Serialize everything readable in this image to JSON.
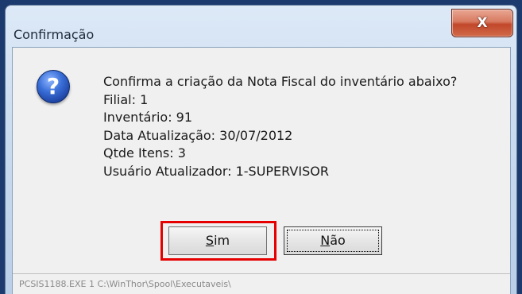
{
  "window": {
    "title": "Confirmação",
    "close_glyph": "X"
  },
  "dialog": {
    "icon": "question-icon",
    "icon_glyph": "?",
    "message_lines": [
      "Confirma a criação da Nota Fiscal do inventário abaixo?",
      "Filial: 1",
      "Inventário: 91",
      "Data Atualização: 30/07/2012",
      "Qtde Itens: 3",
      "Usuário Atualizador: 1-SUPERVISOR"
    ]
  },
  "buttons": {
    "yes_mnemonic": "S",
    "yes_rest": "im",
    "no_mnemonic": "N",
    "no_rest": "ão"
  },
  "status": {
    "text": "PCSIS1188.EXE 1 C:\\WinThor\\Spool\\Executaveis\\"
  },
  "colors": {
    "highlight_box": "#e60000",
    "frame": "#1c3a6e"
  }
}
